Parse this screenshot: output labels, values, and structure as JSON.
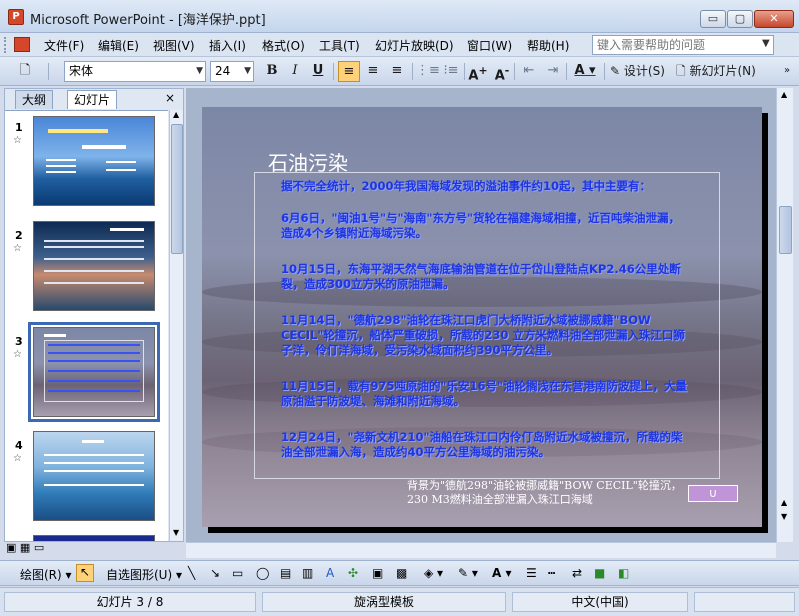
{
  "window": {
    "title": "Microsoft PowerPoint - [海洋保护.ppt]",
    "min_glyph": "▭",
    "max_glyph": "▢",
    "close_glyph": "✕"
  },
  "menu": {
    "items": [
      "文件(F)",
      "编辑(E)",
      "视图(V)",
      "插入(I)",
      "格式(O)",
      "工具(T)",
      "幻灯片放映(D)",
      "窗口(W)",
      "帮助(H)"
    ],
    "help_placeholder": "键入需要帮助的问题"
  },
  "toolbar": {
    "font": "宋体",
    "size": "24",
    "bold": "B",
    "italic": "I",
    "underline": "U",
    "design_label": "设计(S)",
    "new_slide_label": "新幻灯片(N)"
  },
  "left_panel": {
    "tab_outline": "大纲",
    "tab_slides": "幻灯片",
    "close": "×",
    "slides": [
      {
        "num": "1",
        "selected": false
      },
      {
        "num": "2",
        "selected": false
      },
      {
        "num": "3",
        "selected": true
      },
      {
        "num": "4",
        "selected": false
      }
    ]
  },
  "slide": {
    "title": "石油污染",
    "paragraphs": [
      "据不完全统计，2000年我国海域发现的溢油事件约10起，其中主要有：",
      "6月6日，\"闽油1号\"与\"海南\"东方号\"货轮在福建海域相撞，近百吨柴油泄漏，造成4个乡镇附近海域污染。",
      "10月15日，东海平湖天然气海底输油管道在位于岱山登陆点KP2.46公里处断裂，造成300立方米的原油泄漏。",
      "11月14日，\"德航298\"油轮在珠江口虎门大桥附近水域被挪威籍\"BOW CECIL\"轮撞沉，船体严重破损，所载的230 立方米燃料油全部泄漏入珠江口狮子洋，伶仃洋海域，受污染水域面积约390平方公里。",
      "11月15日，载有975吨原油的\"乐安16号\"油轮搁浅在东营港南防波提上，大量原油溢于防波堤、海滩和附近海域。",
      "12月24日，\"尧新文机210\"油船在珠江口内伶仃岛附近水域被撞沉，所载的柴油全部泄漏入海，造成约40平方公里海域的油污染。"
    ],
    "caption": "背景为\"德航298\"油轮被挪威籍\"BOW CECIL\"轮撞沉，230 M3燃料油全部泄漏入珠江口海域",
    "action_button": "∪"
  },
  "drawbar": {
    "draw_label": "绘图(R)",
    "autoshape_label": "自选图形(U)"
  },
  "status": {
    "slide_pos": "幻灯片 3 / 8",
    "template": "旋涡型模板",
    "language": "中文(中国)"
  },
  "colors": {
    "body_text": "#1e35e0",
    "title_text": "#ffffff",
    "selection": "#3d68b4"
  }
}
